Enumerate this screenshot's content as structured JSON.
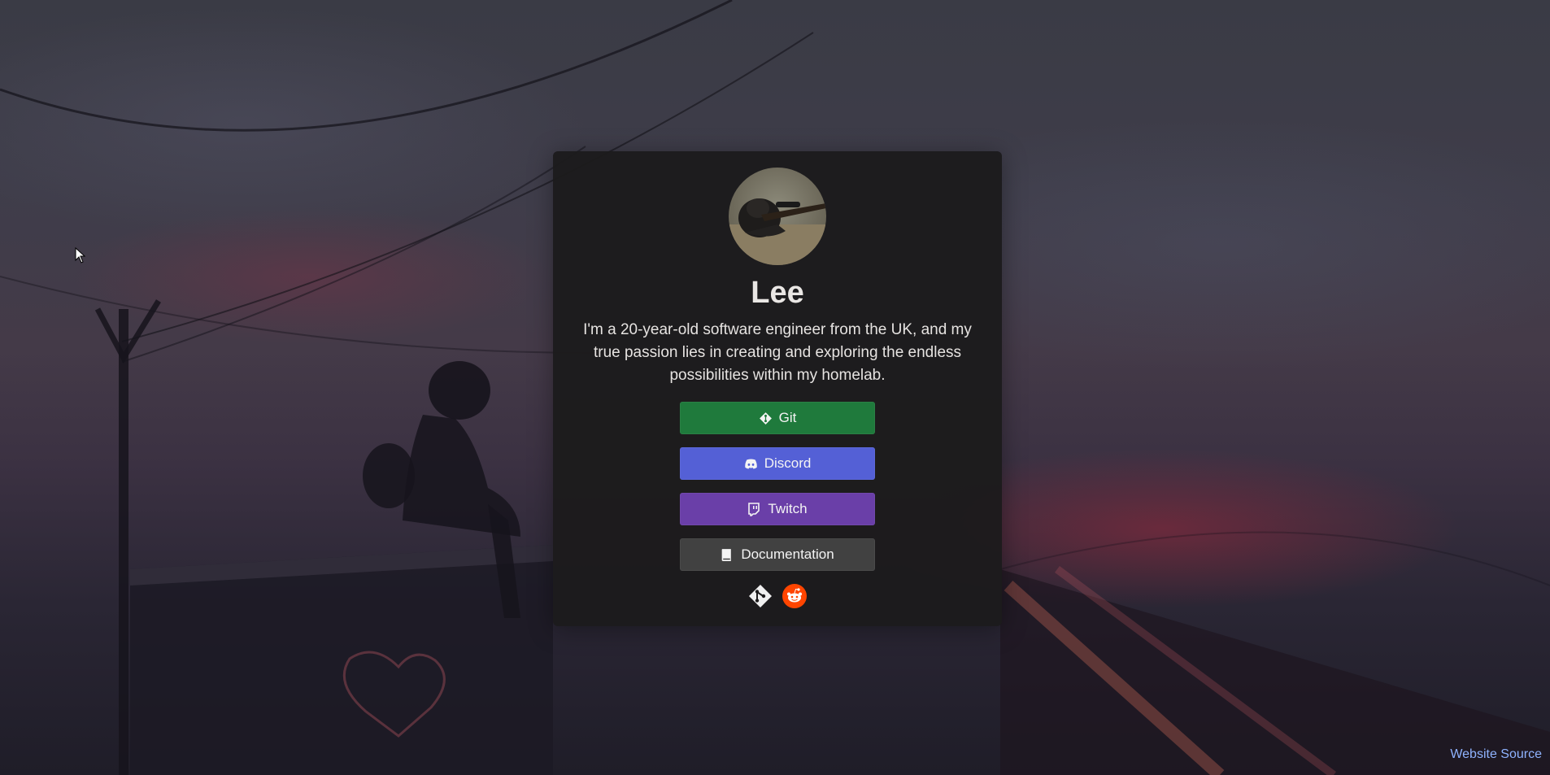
{
  "profile": {
    "name": "Lee",
    "bio": "I'm a 20-year-old software engineer from the UK, and my true passion lies in creating and exploring the endless possibilities within my homelab."
  },
  "buttons": [
    {
      "label": "Git",
      "icon": "git-icon",
      "color": "#1f7a3c"
    },
    {
      "label": "Discord",
      "icon": "discord-icon",
      "color": "#5460d6"
    },
    {
      "label": "Twitch",
      "icon": "twitch-icon",
      "color": "#6a3fa8"
    },
    {
      "label": "Documentation",
      "icon": "book-icon",
      "color": "#414141"
    }
  ],
  "social_icons": [
    {
      "icon": "git-logo-icon"
    },
    {
      "icon": "reddit-icon",
      "color": "#ff4500"
    }
  ],
  "footer": {
    "link_label": "Website Source"
  }
}
